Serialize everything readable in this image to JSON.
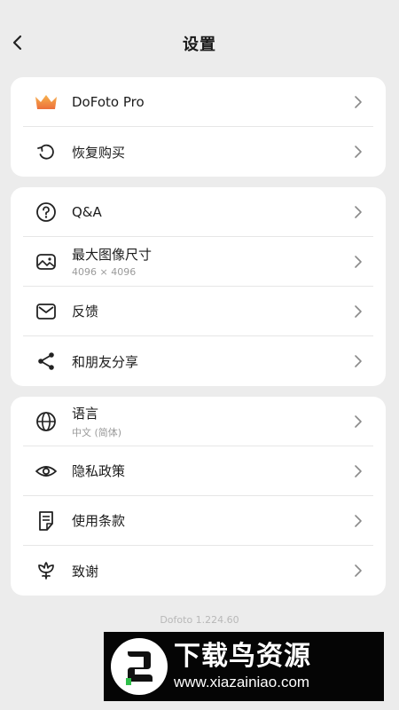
{
  "header": {
    "title": "设置"
  },
  "groups": [
    {
      "items": [
        {
          "icon": "crown-icon",
          "label": "DoFoto Pro"
        },
        {
          "icon": "restore-icon",
          "label": "恢复购买"
        }
      ]
    },
    {
      "items": [
        {
          "icon": "question-icon",
          "label": "Q&A"
        },
        {
          "icon": "image-size-icon",
          "label": "最大图像尺寸",
          "sub": "4096 × 4096"
        },
        {
          "icon": "mail-icon",
          "label": "反馈"
        },
        {
          "icon": "share-icon",
          "label": "和朋友分享"
        }
      ]
    },
    {
      "items": [
        {
          "icon": "globe-icon",
          "label": "语言",
          "sub": "中文 (简体)"
        },
        {
          "icon": "eye-icon",
          "label": "隐私政策"
        },
        {
          "icon": "document-icon",
          "label": "使用条款"
        },
        {
          "icon": "flower-icon",
          "label": "致谢"
        }
      ]
    }
  ],
  "version": "Dofoto 1.224.60",
  "watermark": {
    "cn": "下载鸟资源",
    "url": "www.xiazainiao.com"
  },
  "colors": {
    "accent_crown": "#f08a3c",
    "background": "#ececec",
    "card": "#ffffff"
  }
}
